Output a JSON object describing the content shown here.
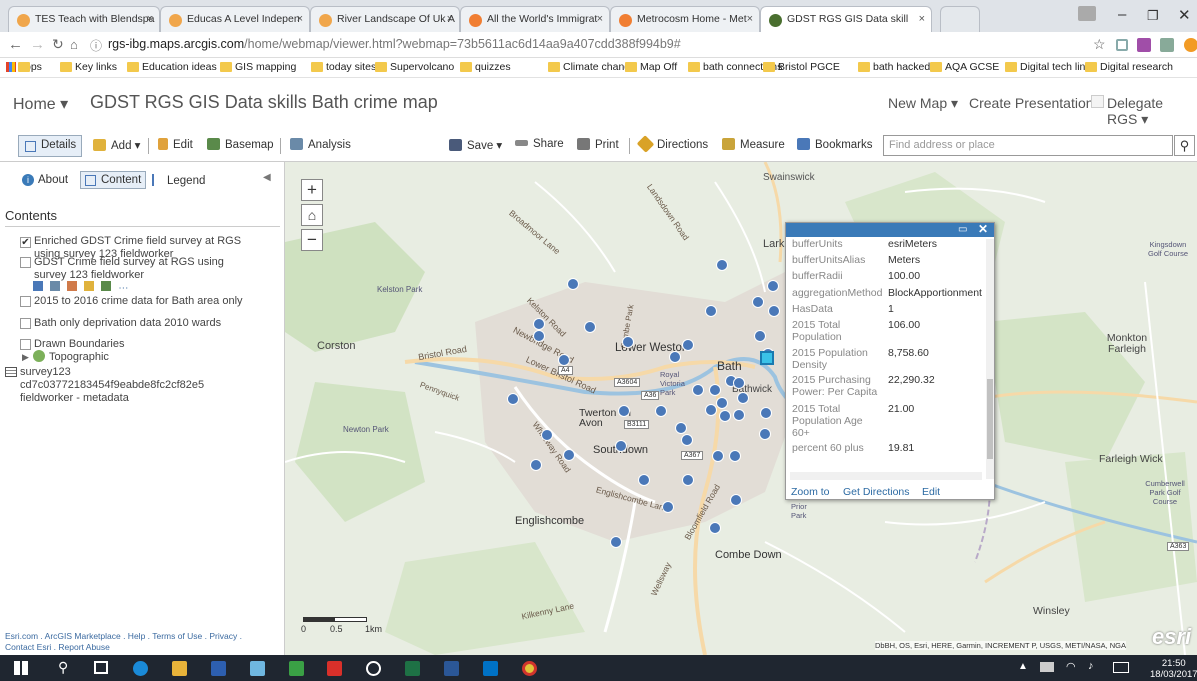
{
  "browser": {
    "tabs": [
      {
        "label": "TES Teach with Blendspa",
        "color": "#f0a64b"
      },
      {
        "label": "Educas A Level Indepen",
        "color": "#f0a64b"
      },
      {
        "label": "River Landscape Of Uk A",
        "color": "#f0a64b"
      },
      {
        "label": "All the World's Immigrat",
        "color": "#f07e32"
      },
      {
        "label": "Metrocosm Home - Met",
        "color": "#f07e32"
      },
      {
        "label": "GDST RGS GIS Data skill",
        "color": "#4a6f2f"
      }
    ],
    "url_host": "rgs-ibg.maps.arcgis.com",
    "url_rest": "/home/webmap/viewer.html?webmap=73b5611ac6d14aa9a407cdd388f994b9#",
    "bookmarks": [
      "Apps",
      "Key links",
      "Education ideas",
      "GIS mapping",
      "today sites",
      "Supervolcano",
      "quizzes",
      "Climate change",
      "Map Off",
      "bath connections",
      "Bristol PGCE",
      "bath hacked",
      "AQA GCSE",
      "Digital tech links",
      "Digital research"
    ]
  },
  "header": {
    "home": "Home ▾",
    "title": "GDST RGS GIS Data skills Bath crime map",
    "new_map": "New Map ▾",
    "create_presentation": "Create Presentation",
    "delegate": "Delegate RGS ▾"
  },
  "toolbar": {
    "details": "Details",
    "add": "Add ▾",
    "edit": "Edit",
    "basemap": "Basemap",
    "analysis": "Analysis",
    "save": "Save ▾",
    "share": "Share",
    "print": "Print",
    "directions": "Directions",
    "measure": "Measure",
    "bookmarks": "Bookmarks",
    "search_placeholder": "Find address or place"
  },
  "panel": {
    "about": "About",
    "content": "Content",
    "legend": "Legend",
    "contents_header": "Contents",
    "layers": [
      "Enriched GDST Crime field survey at RGS using survey 123 fieldworker",
      "GDST Crime field survey at RGS using survey 123 fieldworker",
      "2015 to 2016 crime data for Bath area only",
      "Bath only deprivation data 2010 wards",
      "Drawn Boundaries",
      "Topographic"
    ],
    "table_item_line1": "survey123",
    "table_item_line2": "cd7c03772183454f9eabde8fc2cf82e5",
    "table_item_line3": "fieldworker - metadata",
    "footer_line1": "Esri.com . ArcGIS Marketplace . Help . Terms of Use . Privacy .",
    "footer_line2": "Contact Esri . Report Abuse"
  },
  "map": {
    "places": [
      "Swainswick",
      "Larkhall",
      "Kelston Park",
      "Corston",
      "Lower Weston",
      "Bath",
      "Bathwick",
      "Twerton on Avon",
      "Southdown",
      "Newton Park",
      "Englishcombe",
      "Combe Down",
      "Monkton Farleigh",
      "Farleigh Wick",
      "Winsley",
      "Kingsdown Golf Course",
      "Cumberwell Park Golf Course",
      "Royal Victoria Park",
      "Prior Park"
    ],
    "roads": [
      "Bristol Road",
      "Lower Bristol Road",
      "Newbridge Road",
      "Kelston Road",
      "Bloomfield Road",
      "Englishcombe Lane",
      "Kilkenny Lane",
      "Wellsway",
      "Whiteway Road",
      "Landsdown Road",
      "Broadmoor Lane",
      "Pennyquick",
      "Combe Park"
    ],
    "road_numbers": [
      "A4",
      "A36",
      "A3604",
      "B3111",
      "A367",
      "A363"
    ],
    "scale_labels": [
      "0",
      "0.5",
      "1km"
    ],
    "attribution": "DbBH, OS, Esri, HERE, Garmin, INCREMENT P, USGS, METI/NASA, NGA",
    "esri": "esri",
    "marker_color": "#4a78b8"
  },
  "popup": {
    "fields": [
      {
        "label": "bufferUnits",
        "value": "esriMeters"
      },
      {
        "label": "bufferUnitsAlias",
        "value": "Meters"
      },
      {
        "label": "bufferRadii",
        "value": "100.00"
      },
      {
        "label": "aggregationMethod",
        "value": "BlockApportionment"
      },
      {
        "label": "HasData",
        "value": "1"
      },
      {
        "label": "2015 Total Population",
        "value": "106.00"
      },
      {
        "label": "2015 Population Density",
        "value": "8,758.60"
      },
      {
        "label": "2015 Purchasing Power: Per Capita",
        "value": "22,290.32"
      },
      {
        "label": "2015 Total Population Age 60+",
        "value": "21.00"
      },
      {
        "label": "percent 60 plus",
        "value": "19.81"
      }
    ],
    "zoom_to": "Zoom to",
    "get_directions": "Get Directions",
    "edit": "Edit"
  },
  "taskbar": {
    "time": "21:50",
    "date": "18/03/2017"
  }
}
